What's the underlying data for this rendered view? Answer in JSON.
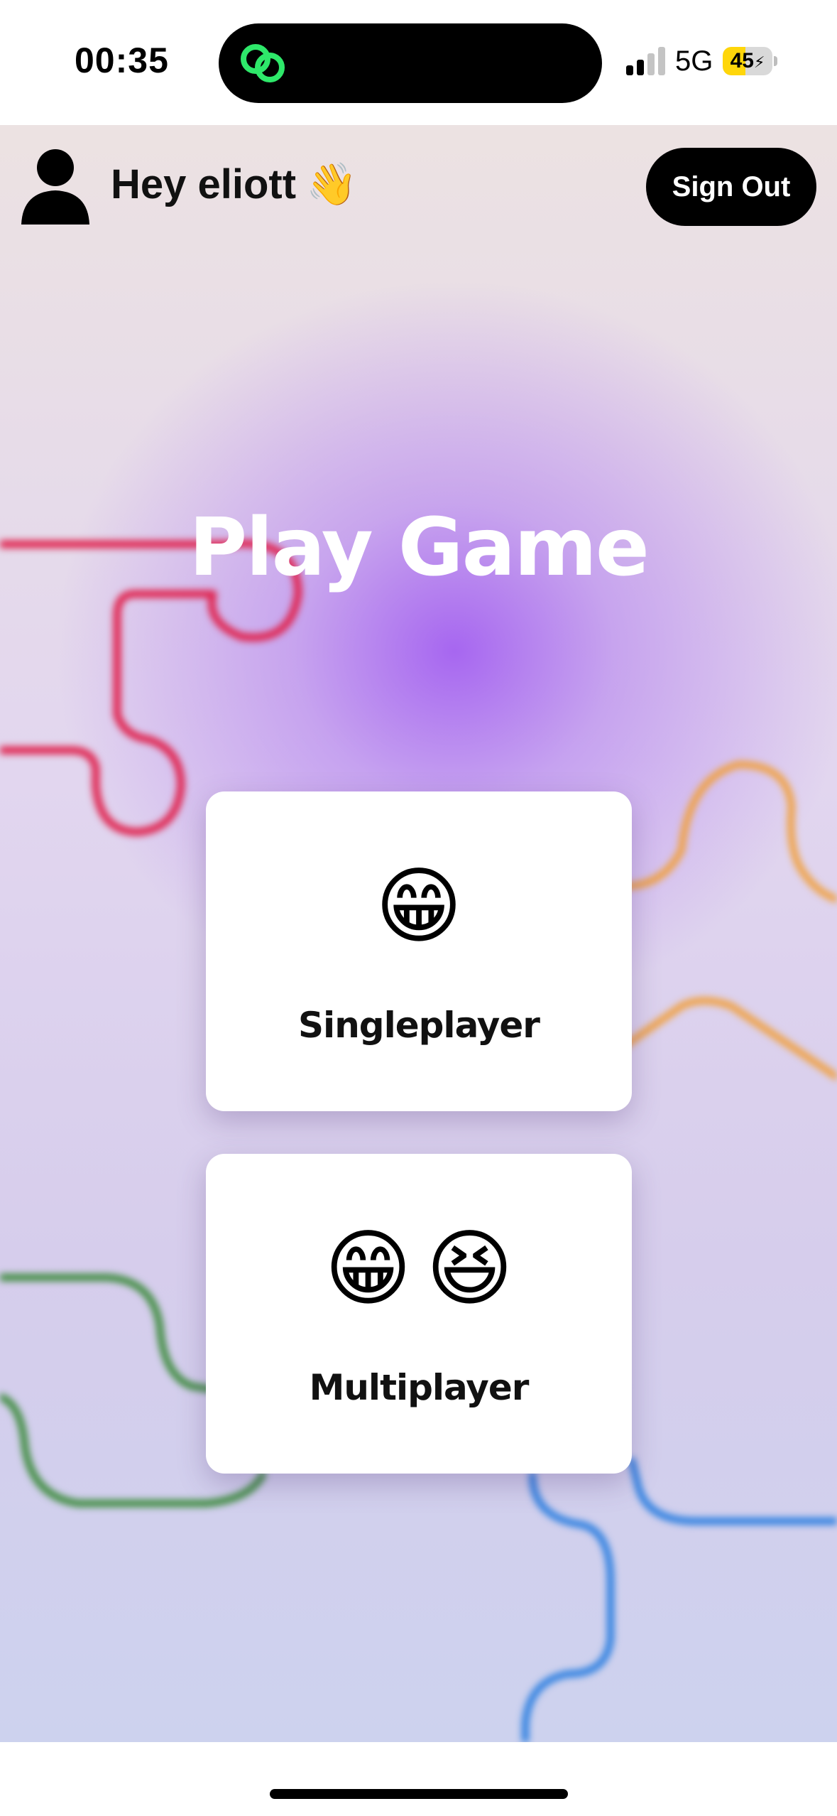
{
  "status_bar": {
    "time": "00:35",
    "network": "5G",
    "battery_percent": 45,
    "battery_label": "45",
    "charging_symbol": "⚡",
    "island_app_icon": "link-rings-icon",
    "signal_icon": "cellular-signal-icon"
  },
  "header": {
    "avatar_icon": "user-silhouette-icon",
    "greeting": "Hey eliott",
    "wave_emoji": "👋",
    "sign_out_label": "Sign Out"
  },
  "main": {
    "title": "Play Game",
    "modes": [
      {
        "emojis": [
          "😁"
        ],
        "label": "Singleplayer"
      },
      {
        "emojis": [
          "😁",
          "😆"
        ],
        "label": "Multiplayer"
      }
    ]
  },
  "colors": {
    "accent_glow": "#a45ef0",
    "line_red": "#e0234e",
    "line_orange": "#f0a040",
    "line_green": "#3a8a3a",
    "line_blue": "#2a7ee0",
    "button_bg": "#000000"
  }
}
